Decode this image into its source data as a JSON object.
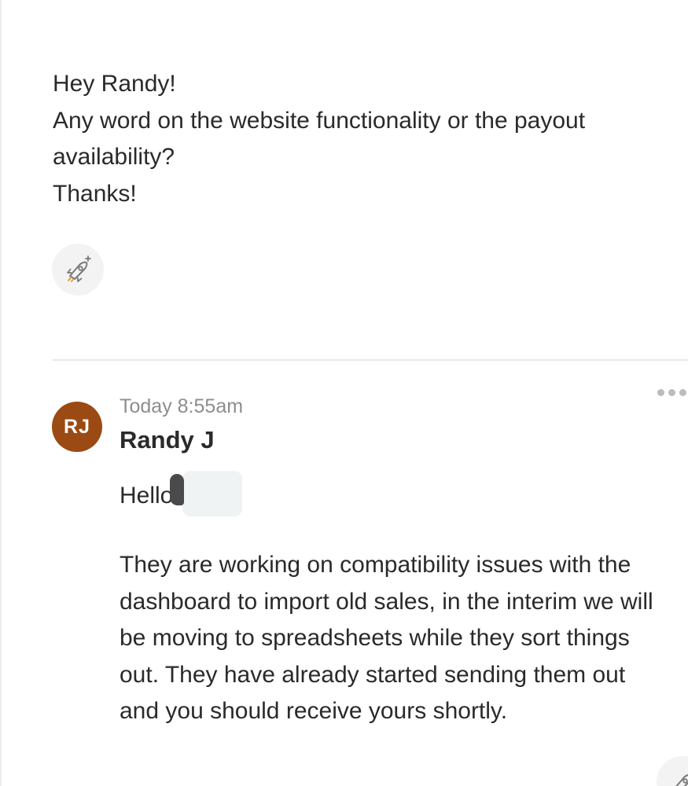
{
  "first_message": {
    "lines": [
      "Hey Randy!",
      "Any word on the website functionality or the payout availability?",
      "Thanks!"
    ]
  },
  "reaction_button": {
    "icon": "rocket-add-reaction-icon"
  },
  "reply": {
    "timestamp": "Today 8:55am",
    "author": "Randy J",
    "avatar_initials": "RJ",
    "avatar_color": "#9a4a12",
    "greeting": "Hello",
    "body": "They are working on compatibility issues with the dashboard to import old sales, in the interim we will be moving to spreadsheets while they sort things out. They have already started sending them out and you should receive yours shortly."
  },
  "more_menu": {
    "icon": "more-horizontal-icon"
  }
}
